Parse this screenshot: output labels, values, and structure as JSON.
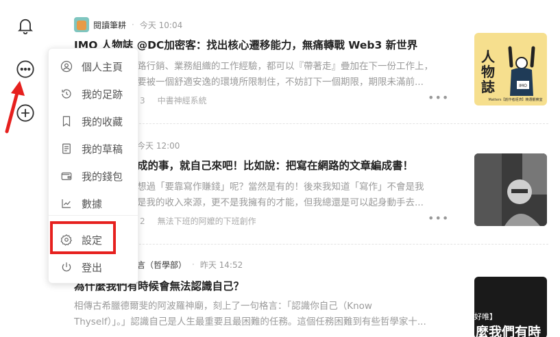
{
  "rail": {
    "icons": [
      "bell-icon",
      "more-circle-icon",
      "add-circle-icon"
    ]
  },
  "menu": {
    "items": [
      {
        "label": "個人主頁",
        "icon": "user-circle-icon"
      },
      {
        "label": "我的足跡",
        "icon": "history-icon"
      },
      {
        "label": "我的收藏",
        "icon": "bookmark-icon"
      },
      {
        "label": "我的草稿",
        "icon": "draft-icon"
      },
      {
        "label": "我的錢包",
        "icon": "wallet-icon"
      },
      {
        "label": "數據",
        "icon": "chart-icon"
      },
      {
        "label": "設定",
        "icon": "settings-icon"
      },
      {
        "label": "登出",
        "icon": "power-icon"
      }
    ]
  },
  "articles": [
    {
      "author": "閱讀筆耕",
      "time": "今天 10:04",
      "title": "IMO 人物誌 @DC加密客：找出核心遷移能力，無痛轉戰 Web3 新世界",
      "excerpt_1": "路行銷、業務組織的工作經驗，都可以『帶著走』疊加在下一份工作上，",
      "excerpt_2": "要被一個舒適安逸的環境所限制住，不妨訂下一個期限，期限未滿前...",
      "count": "3",
      "circle": "中書神經系統",
      "thumb_title": "人物誌",
      "thumb_caption": "Matters【創作者經濟】精選觀察室"
    },
    {
      "author": "",
      "time": "今天 12:00",
      "title": "成的事，就自己來吧！比如說：把寫在網路的文章編成書！",
      "excerpt_1": "想過「要靠寫作賺錢」呢？當然是有的！後來我知道「寫作」不會是我",
      "excerpt_2": "是我的收入來源，更不是我擁有的才能，但我總還是可以起身動手去...",
      "count": "2",
      "circle": "無法下班的阿嬤的下班創作"
    },
    {
      "author": "言（哲學部）",
      "time": "昨天 14:52",
      "title": "為什麼我們有時候會無法認識自己？",
      "excerpt_1": "相傳古希臘德爾斐的阿波羅神廟，刻上了一句格言：「認識你自己（Know",
      "excerpt_2": "Thyself）」。」認識自己是人生最重要且最困難的任務。這個任務困難到有些哲學家十...",
      "thumb_text_1": "好唯】",
      "thumb_text_2": "麼我們有時"
    }
  ],
  "colors": {
    "highlight": "#e6201e",
    "accent_text": "#222222"
  }
}
